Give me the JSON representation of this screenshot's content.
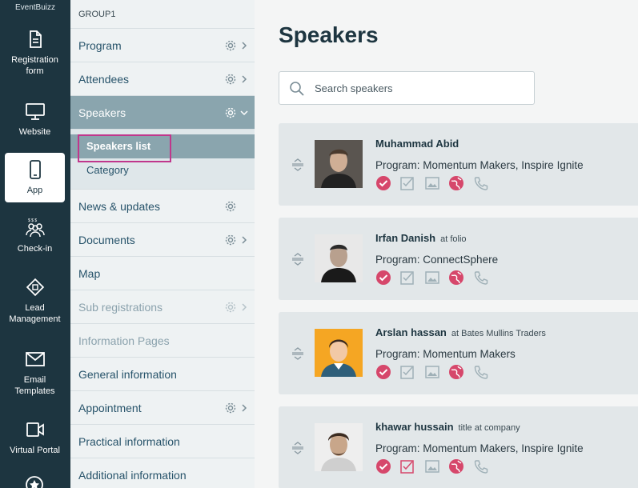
{
  "brand": "EventBuizz",
  "rail": [
    {
      "label": "Registration form",
      "icon": "document-icon"
    },
    {
      "label": "Website",
      "icon": "monitor-icon"
    },
    {
      "label": "App",
      "icon": "phone-icon"
    },
    {
      "label": "Check-in",
      "icon": "people-icon"
    },
    {
      "label": "Lead Management",
      "icon": "lead-icon"
    },
    {
      "label": "Email Templates",
      "icon": "mail-icon"
    },
    {
      "label": "Virtual Portal",
      "icon": "video-icon"
    }
  ],
  "nav": {
    "group": "GROUP1",
    "items": [
      {
        "label": "Program"
      },
      {
        "label": "Attendees"
      },
      {
        "label": "Speakers"
      },
      {
        "label": "Speakers list"
      },
      {
        "label": "Category"
      },
      {
        "label": "News & updates"
      },
      {
        "label": "Documents"
      },
      {
        "label": "Map"
      },
      {
        "label": "Sub registrations"
      },
      {
        "label": "Information Pages"
      },
      {
        "label": "General information"
      },
      {
        "label": "Appointment"
      },
      {
        "label": "Practical information"
      },
      {
        "label": "Additional information"
      }
    ]
  },
  "main": {
    "title": "Speakers",
    "search_placeholder": "Search speakers"
  },
  "speakers": [
    {
      "name": "Muhammad Abid",
      "subtitle": "",
      "program": "Program: Momentum Makers, Inspire Ignite"
    },
    {
      "name": "Irfan Danish",
      "subtitle": "at folio",
      "program": "Program: ConnectSphere"
    },
    {
      "name": "Arslan hassan",
      "subtitle": "at Bates Mullins Traders",
      "program": "Program: Momentum Makers"
    },
    {
      "name": "khawar hussain",
      "subtitle": "title at company",
      "program": "Program: Momentum Makers, Inspire Ignite"
    }
  ],
  "colors": {
    "rail_bg": "#1d3540",
    "nav_active": "#8aa5ae",
    "accent_pink": "#d6476b",
    "highlight": "#c0378c"
  }
}
